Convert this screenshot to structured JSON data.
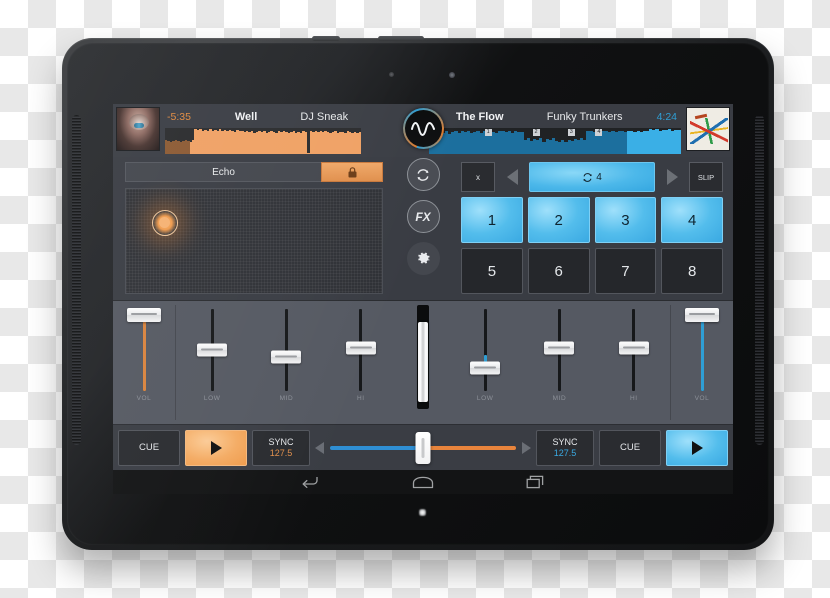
{
  "app": {
    "name": "dj-mixer-app"
  },
  "deck_left": {
    "time": "-5:35",
    "title": "Well",
    "artist": "DJ Sneak",
    "artwork": "album-art-native-headdress",
    "accent": "#e8843c",
    "waveform": {
      "played_fraction": 0.12,
      "bars": [
        0.52,
        0.5,
        0.48,
        0.5,
        0.55,
        0.5,
        0.47,
        0.49,
        0.53,
        0.5,
        0.48,
        0.52,
        0.95,
        0.92,
        0.98,
        0.9,
        0.94,
        0.88,
        0.96,
        0.9,
        0.93,
        0.87,
        0.95,
        0.9,
        0.92,
        0.88,
        0.94,
        0.9,
        0.86,
        0.92,
        0.88,
        0.9,
        0.84,
        0.9,
        0.86,
        0.88,
        0.82,
        0.86,
        0.9,
        0.84,
        0.88,
        0.82,
        0.86,
        0.9,
        0.85,
        0.8,
        0.88,
        0.84,
        0.9,
        0.86,
        0.8,
        0.84,
        0.88,
        0.82,
        0.86,
        0.8,
        0.9,
        0.84,
        0.05,
        0.9,
        0.86,
        0.9,
        0.84,
        0.88,
        0.86,
        0.9,
        0.85,
        0.82,
        0.86,
        0.88,
        0.8,
        0.84,
        0.86,
        0.82,
        0.88,
        0.84,
        0.8,
        0.86,
        0.82,
        0.84
      ]
    },
    "fx": {
      "name": "Echo",
      "lock_icon": "lock-icon",
      "pad_x": 0.1,
      "pad_y": 0.2
    },
    "mixer": {
      "vol_label": "VOL",
      "vol_value": 0.93,
      "eq": [
        {
          "label": "LOW",
          "value": 0.5
        },
        {
          "label": "MID",
          "value": 0.42
        },
        {
          "label": "HI",
          "value": 0.52
        }
      ]
    },
    "transport": {
      "cue_label": "CUE",
      "play_icon": "play-icon",
      "sync_label": "SYNC",
      "bpm": "127.5"
    }
  },
  "deck_right": {
    "time": "4:24",
    "title": "The Flow",
    "artist": "Funky Trunkers",
    "artwork": "album-art-abstract-colors",
    "accent": "#2f9ed4",
    "waveform": {
      "loop_start_fraction": 0.78,
      "cue_markers": [
        "1",
        "2",
        "3",
        "4"
      ],
      "cue_positions": [
        0.22,
        0.41,
        0.55,
        0.66
      ],
      "bars": [
        0.85,
        0.9,
        0.8,
        0.88,
        0.82,
        0.9,
        0.78,
        0.86,
        0.9,
        0.8,
        0.88,
        0.84,
        0.9,
        0.8,
        0.86,
        0.9,
        0.82,
        0.88,
        0.84,
        0.9,
        0.86,
        0.8,
        0.88,
        0.9,
        0.84,
        0.88,
        0.82,
        0.9,
        0.86,
        0.84,
        0.55,
        0.6,
        0.5,
        0.58,
        0.52,
        0.6,
        0.48,
        0.56,
        0.52,
        0.6,
        0.5,
        0.45,
        0.52,
        0.48,
        0.55,
        0.5,
        0.58,
        0.52,
        0.6,
        0.55,
        0.88,
        0.9,
        0.84,
        0.9,
        0.86,
        0.88,
        0.9,
        0.84,
        0.9,
        0.86,
        0.88,
        0.9,
        0.85,
        0.9,
        0.88,
        0.86,
        0.9,
        0.84,
        0.9,
        0.88,
        0.95,
        0.92,
        0.96,
        0.9,
        0.94,
        0.92,
        0.96,
        0.9,
        0.94,
        0.92
      ]
    },
    "pads": {
      "x_label": "x",
      "slip_label": "SLIP",
      "prev_icon": "chevron-left-icon",
      "next_icon": "chevron-right-icon",
      "loop_icon": "loop-icon",
      "loop_beats": "4",
      "cue_pads": [
        {
          "label": "1",
          "active": true
        },
        {
          "label": "2",
          "active": true
        },
        {
          "label": "3",
          "active": true
        },
        {
          "label": "4",
          "active": true
        },
        {
          "label": "5",
          "active": false
        },
        {
          "label": "6",
          "active": false
        },
        {
          "label": "7",
          "active": false
        },
        {
          "label": "8",
          "active": false
        }
      ]
    },
    "mixer": {
      "vol_label": "VOL",
      "vol_value": 0.93,
      "eq": [
        {
          "label": "LOW",
          "value": 0.28
        },
        {
          "label": "MID",
          "value": 0.52
        },
        {
          "label": "HI",
          "value": 0.52
        }
      ]
    },
    "transport": {
      "cue_label": "CUE",
      "play_icon": "play-icon",
      "sync_label": "SYNC",
      "bpm": "127.5"
    }
  },
  "center": {
    "logo_icon": "waveform-logo-icon",
    "loop_sync_icon": "loop-arrows-icon",
    "fx_label": "FX",
    "settings_icon": "gear-icon",
    "channel_fader_value": 0.5
  },
  "crossfader": {
    "value": 0.5,
    "left_color": "#2f8fd4",
    "right_color": "#e8843c",
    "left_arrow_icon": "triangle-left-icon",
    "right_arrow_icon": "triangle-right-icon"
  },
  "android_nav": {
    "back_icon": "back-arrow-icon",
    "home_icon": "home-icon",
    "recents_icon": "recent-apps-icon"
  }
}
